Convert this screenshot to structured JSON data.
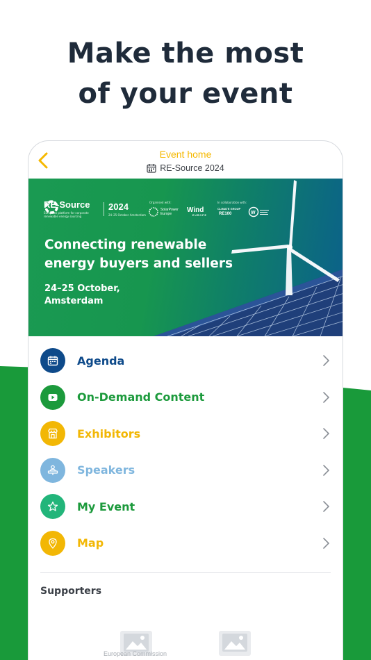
{
  "headline": {
    "line1": "Make the most",
    "line2": "of your event"
  },
  "colors": {
    "brand_green": "#199a3a",
    "accent_yellow": "#f5b800",
    "navy": "#1f2b3a"
  },
  "topbar": {
    "title": "Event home",
    "subtitle": "RE-Source 2024",
    "back_icon": "chevron-left-icon",
    "calendar_icon": "calendar-icon"
  },
  "banner": {
    "brand": "RE-Source",
    "brand_sub": "European platform for corporate renewable energy sourcing",
    "year": "2024",
    "year_sub": "24–25 October Amsterdam",
    "organised_label": "Organised with:",
    "collab_label": "In collaboration with:",
    "partner1": "SolarPower Europe",
    "partner2": "Wind",
    "partner2_sub": "EUROPE",
    "partner3": "CLIMATE GROUP",
    "partner3_sub": "RE100",
    "headline": "Connecting renewable energy buyers and sellers",
    "date_line1": "24–25 October,",
    "date_line2": "Amsterdam"
  },
  "menu": [
    {
      "label": "Agenda",
      "color": "#0e4a8a",
      "icon_bg": "#0e4a8a",
      "icon": "calendar-icon"
    },
    {
      "label": "On-Demand Content",
      "color": "#1c9a3c",
      "icon_bg": "#1c9a3c",
      "icon": "play-icon"
    },
    {
      "label": "Exhibitors",
      "color": "#f2b705",
      "icon_bg": "#f2b705",
      "icon": "store-icon"
    },
    {
      "label": "Speakers",
      "color": "#7fb6de",
      "icon_bg": "#7fb6de",
      "icon": "speaker-icon"
    },
    {
      "label": "My Event",
      "color": "#1c9a3c",
      "icon_bg": "#22b57a",
      "icon": "star-icon"
    },
    {
      "label": "Map",
      "color": "#f2b705",
      "icon_bg": "#f2b705",
      "icon": "map-pin-icon"
    }
  ],
  "supporters": {
    "title": "Supporters",
    "caption": "European Commission"
  }
}
